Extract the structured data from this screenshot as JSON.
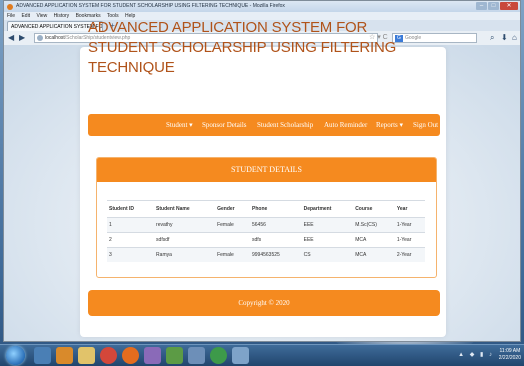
{
  "browser": {
    "window_title": "ADVANCED APPLICATION SYSTEM FOR STUDENT SCHOLARSHIP USING FILTERING TECHNIQUE - Mozilla Firefox",
    "menu": [
      "File",
      "Edit",
      "View",
      "History",
      "Bookmarks",
      "Tools",
      "Help"
    ],
    "tab_title": "ADVANCED APPLICATION SYSTEM FOR...",
    "new_tab": "+",
    "url_host": "localhost",
    "url_path": "/ScholarShip/studentview.php",
    "search_placeholder": "Google",
    "search_engine": "G"
  },
  "page": {
    "title": "ADVANCED APPLICATION SYSTEM FOR STUDENT SCHOLARSHIP USING FILTERING TECHNIQUE",
    "nav": {
      "student": "Student ▾",
      "sponsor_details": "Sponsor Details",
      "student_scholarship": "Student Scholarship",
      "auto_reminder": "Auto Reminder",
      "reports": "Reports ▾",
      "sign_out": "Sign Out"
    },
    "panel_title": "STUDENT DETAILS",
    "table": {
      "headers": [
        "Student ID",
        "Student Name",
        "Gender",
        "Phone",
        "Department",
        "Course",
        "Year"
      ],
      "rows": [
        [
          "1",
          "revathy",
          "Female",
          "56456",
          "EEE",
          "M.Sc(CS)",
          "1-Year"
        ],
        [
          "2",
          "sdfsdf",
          "",
          "sdfs",
          "EEE",
          "MCA",
          "1-Year"
        ],
        [
          "3",
          "Ramya",
          "Female",
          "9994563525",
          "CS",
          "MCA",
          "2-Year"
        ]
      ]
    },
    "footer": "Copyright © 2020"
  },
  "taskbar": {
    "clock_time": "11:09 AM",
    "clock_date": "2/22/2020"
  },
  "colors": {
    "accent": "#f58a1f",
    "title": "#b0531a"
  }
}
